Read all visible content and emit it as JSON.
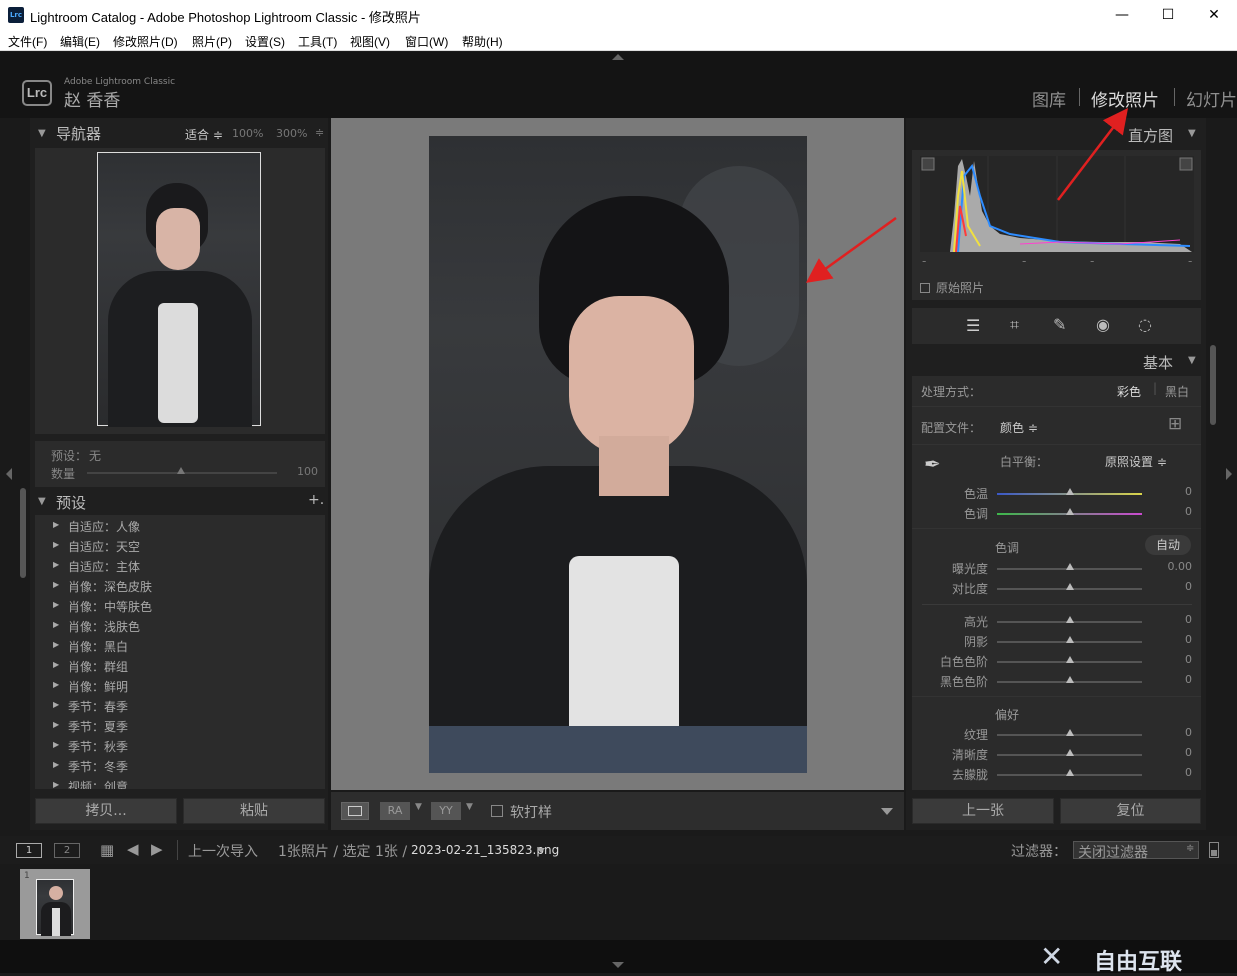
{
  "window": {
    "title": "Lightroom Catalog - Adobe Photoshop Lightroom Classic - 修改照片",
    "icon_label": "Lrc",
    "controls": [
      "—",
      "☐",
      "✕"
    ]
  },
  "menu": [
    "文件(F)",
    "编辑(E)",
    "修改照片(D)",
    "照片(P)",
    "设置(S)",
    "工具(T)",
    "视图(V)",
    "窗口(W)",
    "帮助(H)"
  ],
  "header": {
    "logo": "Lrc",
    "app_name": "Adobe Lightroom Classic",
    "user_name": "赵 香香",
    "modules": [
      "图库",
      "修改照片",
      "幻灯片"
    ]
  },
  "navigator": {
    "title": "导航器",
    "zoom_fit": "适合 ≑",
    "zoom_100": "100%",
    "zoom_300": "300%",
    "zoom_arrow": "≑"
  },
  "preset_amount": {
    "preset_label": "预设：",
    "preset_value": "无",
    "amount_label": "数量",
    "amount_value": "100"
  },
  "presets": {
    "title": "预设",
    "add": "+.",
    "items": [
      "自适应：人像",
      "自适应：天空",
      "自适应：主体",
      "肖像：深色皮肤",
      "肖像：中等肤色",
      "肖像：浅肤色",
      "肖像：黑白",
      "肖像：群组",
      "肖像：鲜明",
      "季节：春季",
      "季节：夏季",
      "季节：秋季",
      "季节：冬季",
      "视频：创意"
    ]
  },
  "left_buttons": {
    "copy": "拷贝...",
    "paste": "粘贴"
  },
  "toolbar": {
    "ra": "RA",
    "yy": "YY",
    "soft_proof": "软打样"
  },
  "histogram": {
    "title": "直方图",
    "original": "原始照片",
    "ticks": [
      "-",
      "-",
      "-",
      "-"
    ]
  },
  "basic": {
    "title": "基本",
    "treatment_label": "处理方式：",
    "treatment_color": "彩色",
    "treatment_bw": "黑白",
    "profile_label": "配置文件：",
    "profile_value": "颜色 ≑",
    "wb_label": "白平衡：",
    "wb_value": "原照设置 ≑",
    "temp_label": "色温",
    "temp_value": "0",
    "tint_label": "色调",
    "tint_value": "0",
    "tone_label": "色调",
    "auto": "自动",
    "tone_sliders": [
      {
        "label": "曝光度",
        "value": "0.00"
      },
      {
        "label": "对比度",
        "value": "0"
      },
      {
        "label": "高光",
        "value": "0"
      },
      {
        "label": "阴影",
        "value": "0"
      },
      {
        "label": "白色色阶",
        "value": "0"
      },
      {
        "label": "黑色色阶",
        "value": "0"
      }
    ],
    "presence_label": "偏好",
    "presence_sliders": [
      {
        "label": "纹理",
        "value": "0"
      },
      {
        "label": "清晰度",
        "value": "0"
      },
      {
        "label": "去朦胧",
        "value": "0"
      }
    ]
  },
  "right_buttons": {
    "prev": "上一张",
    "reset": "复位"
  },
  "filmstrip": {
    "view1": "1",
    "view2": "2",
    "source": "上一次导入",
    "count": "1张照片 / 选定 1张 /",
    "filename": "2023-02-21_135823.png",
    "filter_label": "过滤器：",
    "filter_value": "关闭过滤器",
    "thumb_index": "1"
  },
  "watermark": "自由互联"
}
